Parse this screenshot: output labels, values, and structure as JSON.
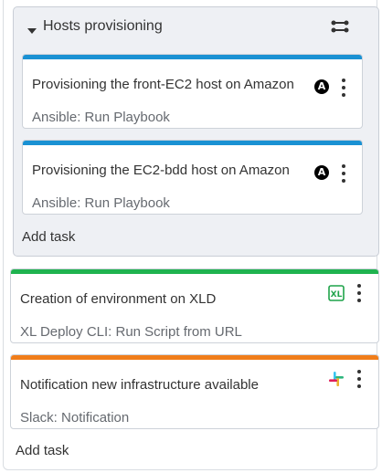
{
  "group": {
    "title": "Hosts provisioning",
    "add_task_label": "Add task",
    "tasks": [
      {
        "title": "Provisioning the front-EC2 host on Amazon",
        "subtitle": "Ansible: Run Playbook",
        "icon": "ansible-icon",
        "accent": "#1a91d3"
      },
      {
        "title": "Provisioning the EC2-bdd host on Amazon",
        "subtitle": "Ansible: Run Playbook",
        "icon": "ansible-icon",
        "accent": "#1a91d3"
      }
    ]
  },
  "tasks": [
    {
      "title": "Creation of environment on XLD",
      "subtitle": "XL Deploy CLI: Run Script from URL",
      "icon": "xl-deploy-icon",
      "accent": "#1fb34f"
    },
    {
      "title": "Notification new infrastructure available",
      "subtitle": "Slack: Notification",
      "icon": "slack-icon",
      "accent": "#f07d1a"
    }
  ],
  "add_task_label": "Add task",
  "icons": {
    "ansible_letter": "A",
    "xl_letters": "XL"
  }
}
